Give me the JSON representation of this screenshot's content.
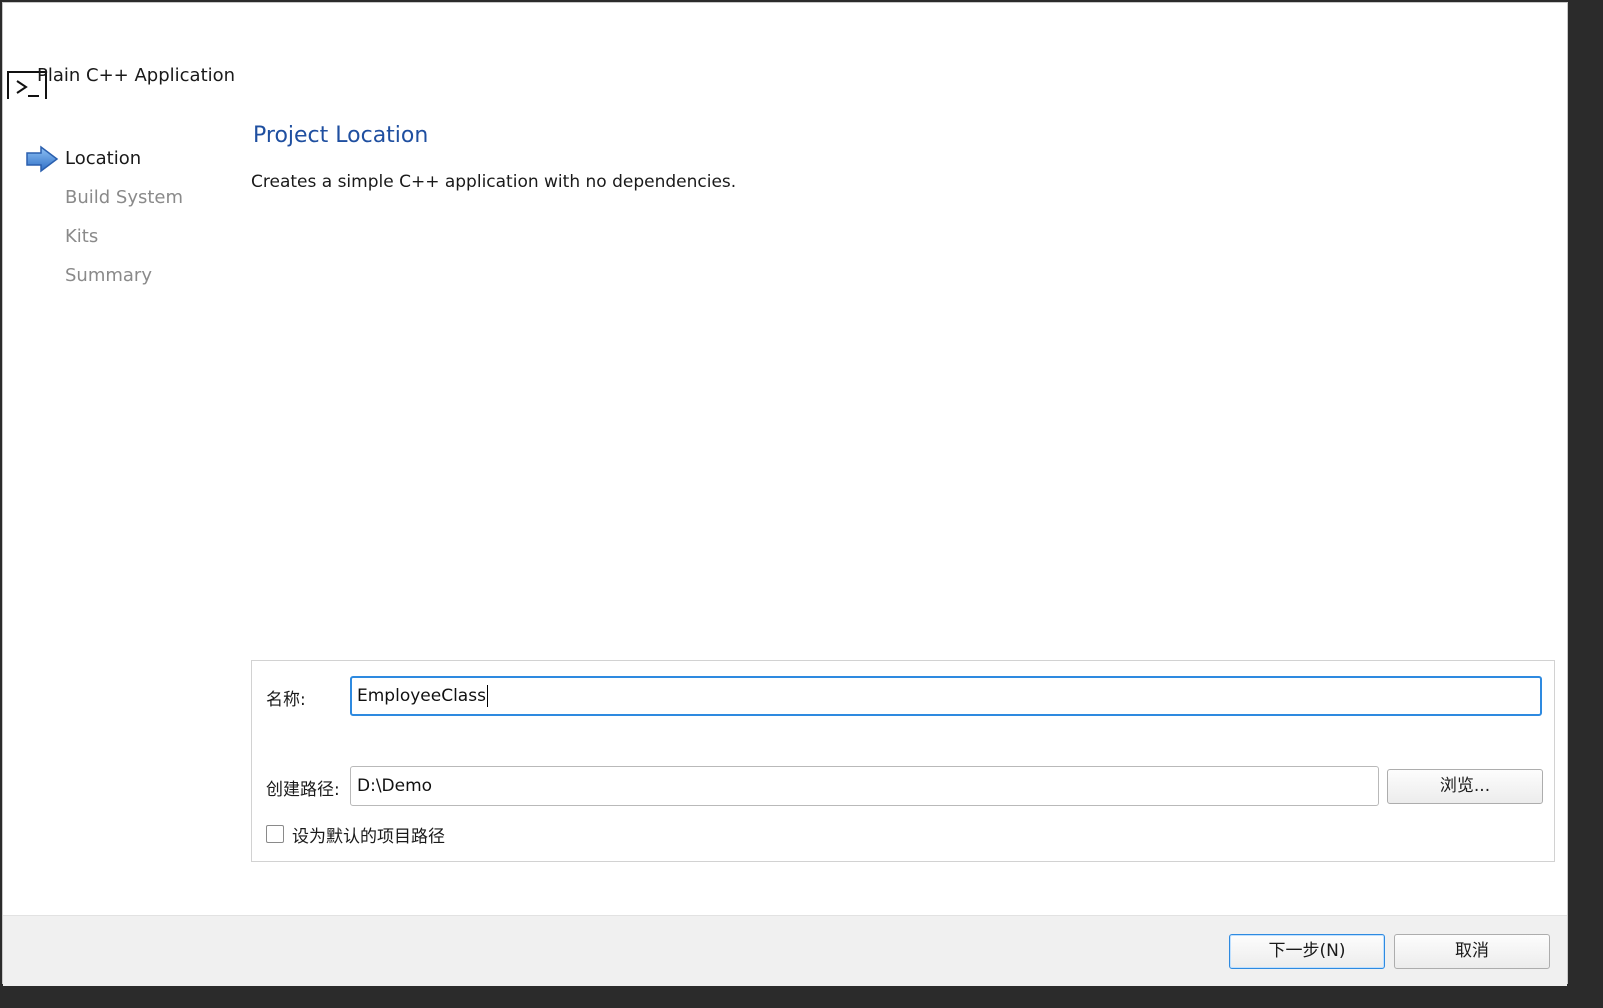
{
  "window": {
    "app_title": "Plain C++ Application",
    "app_icon": "terminal-icon"
  },
  "steps": [
    {
      "label": "Location",
      "active": true
    },
    {
      "label": "Build System",
      "active": false
    },
    {
      "label": "Kits",
      "active": false
    },
    {
      "label": "Summary",
      "active": false
    }
  ],
  "page": {
    "title": "Project Location",
    "description": "Creates a simple C++ application with no dependencies."
  },
  "form": {
    "name_label": "名称:",
    "name_value": "EmployeeClass",
    "path_label": "创建路径:",
    "path_value": "D:\\Demo",
    "browse_label": "浏览...",
    "default_path_label": "设为默认的项目路径",
    "default_path_checked": false
  },
  "footer": {
    "next_label": "下一步(N)",
    "cancel_label": "取消"
  },
  "colors": {
    "title_blue": "#1f4fa0",
    "focus_blue": "#2e8ae0",
    "arrow_blue": "#3d7fd6"
  }
}
